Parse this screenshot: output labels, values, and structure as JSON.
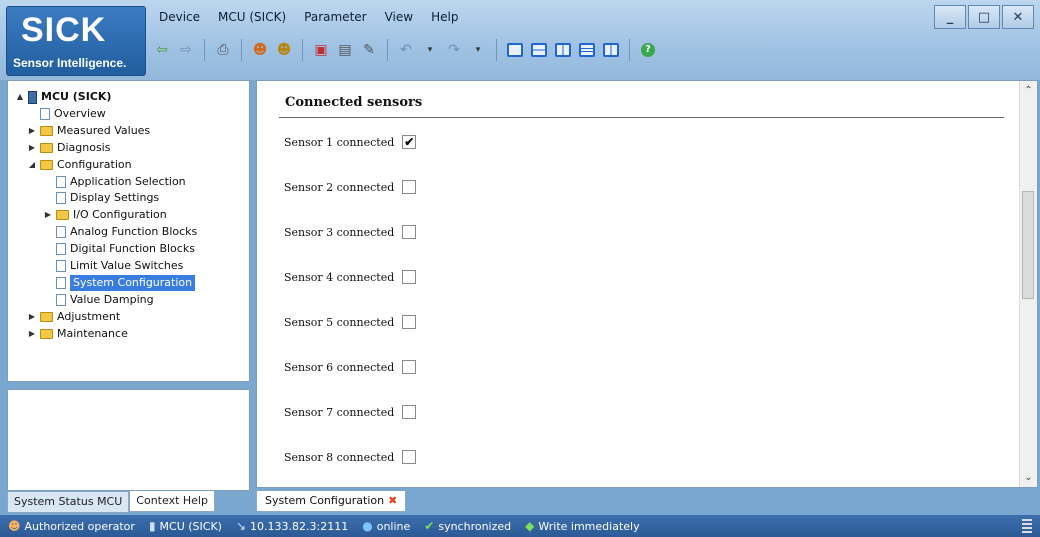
{
  "logo": {
    "brand": "SICK",
    "tagline": "Sensor Intelligence."
  },
  "menu": [
    "Device",
    "MCU (SICK)",
    "Parameter",
    "View",
    "Help"
  ],
  "window_buttons": [
    "_",
    "□",
    "✕"
  ],
  "tree": [
    {
      "label": "MCU (SICK)",
      "level": 0,
      "icon": "device-icon",
      "expander": "▲",
      "bold": true
    },
    {
      "label": "Overview",
      "level": 1,
      "icon": "page-icon",
      "expander": ""
    },
    {
      "label": "Measured Values",
      "level": 1,
      "icon": "folder-icon",
      "expander": "▶"
    },
    {
      "label": "Diagnosis",
      "level": 1,
      "icon": "folder-icon",
      "expander": "▶"
    },
    {
      "label": "Configuration",
      "level": 1,
      "icon": "folder-icon",
      "expander": "◢"
    },
    {
      "label": "Application Selection",
      "level": 2,
      "icon": "page-icon",
      "expander": ""
    },
    {
      "label": "Display Settings",
      "level": 2,
      "icon": "page-icon",
      "expander": ""
    },
    {
      "label": "I/O Configuration",
      "level": 2,
      "icon": "folder-icon",
      "expander": "▶"
    },
    {
      "label": "Analog Function Blocks",
      "level": 2,
      "icon": "page-icon",
      "expander": ""
    },
    {
      "label": "Digital Function Blocks",
      "level": 2,
      "icon": "page-icon",
      "expander": ""
    },
    {
      "label": "Limit Value Switches",
      "level": 2,
      "icon": "page-icon",
      "expander": ""
    },
    {
      "label": "System Configuration",
      "level": 2,
      "icon": "page-icon",
      "expander": "",
      "selected": true
    },
    {
      "label": "Value Damping",
      "level": 2,
      "icon": "page-icon",
      "expander": ""
    },
    {
      "label": "Adjustment",
      "level": 1,
      "icon": "folder-icon",
      "expander": "▶"
    },
    {
      "label": "Maintenance",
      "level": 1,
      "icon": "folder-icon",
      "expander": "▶"
    }
  ],
  "left_tabs": [
    "System Status MCU",
    "Context Help"
  ],
  "content": {
    "section_title": "Connected sensors",
    "sensors": [
      {
        "label": "Sensor 1 connected",
        "checked": true
      },
      {
        "label": "Sensor 2 connected",
        "checked": false
      },
      {
        "label": "Sensor 3 connected",
        "checked": false
      },
      {
        "label": "Sensor 4 connected",
        "checked": false
      },
      {
        "label": "Sensor 5 connected",
        "checked": false
      },
      {
        "label": "Sensor 6 connected",
        "checked": false
      },
      {
        "label": "Sensor 7 connected",
        "checked": false
      },
      {
        "label": "Sensor 8 connected",
        "checked": false
      }
    ]
  },
  "content_tab": {
    "label": "System Configuration",
    "close": "✖"
  },
  "status": {
    "user": "Authorized operator",
    "device": "MCU (SICK)",
    "address": "10.133.82.3:2111",
    "online": "online",
    "sync": "synchronized",
    "write": "Write immediately"
  },
  "colors": {
    "accent": "#3a7de0",
    "statusbar": "#2b5a95",
    "brand": "#215e9f"
  }
}
